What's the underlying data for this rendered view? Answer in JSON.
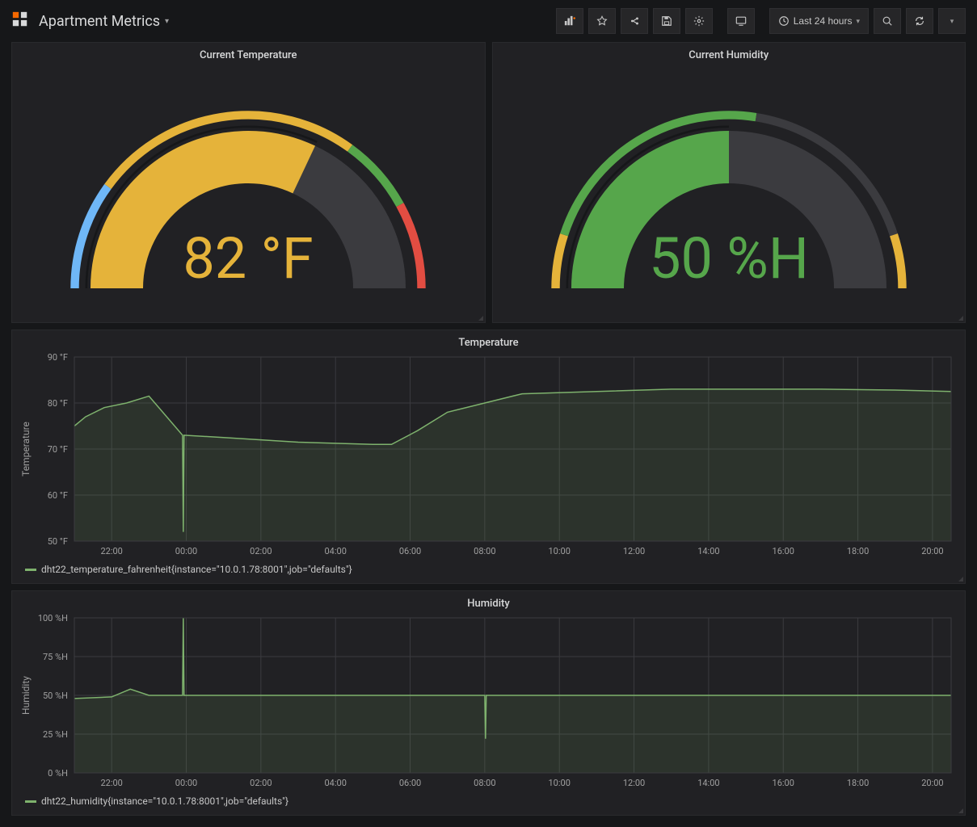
{
  "header": {
    "title": "Apartment Metrics",
    "time_range_label": "Last 24 hours"
  },
  "gauges": {
    "temperature_title": "Current Temperature",
    "temperature_value": "82 °F",
    "humidity_title": "Current Humidity",
    "humidity_value": "50 %H"
  },
  "temp_chart": {
    "title": "Temperature",
    "ylabel": "Temperature",
    "legend": "dht22_temperature_fahrenheit{instance=\"10.0.1.78:8001\",job=\"defaults\"}"
  },
  "hum_chart": {
    "title": "Humidity",
    "ylabel": "Humidity",
    "legend": "dht22_humidity{instance=\"10.0.1.78:8001\",job=\"defaults\"}"
  },
  "chart_data": [
    {
      "type": "gauge",
      "title": "Current Temperature",
      "value": 82,
      "unit": "°F",
      "min": 50,
      "max": 100,
      "thresholds": [
        {
          "from": 50,
          "to": 60,
          "color": "#6fb7f7"
        },
        {
          "from": 60,
          "to": 85,
          "color": "#e5b33a"
        },
        {
          "from": 85,
          "to": 92,
          "color": "#56a64b"
        },
        {
          "from": 92,
          "to": 100,
          "color": "#e24d42"
        }
      ]
    },
    {
      "type": "gauge",
      "title": "Current Humidity",
      "value": 50,
      "unit": "%H",
      "min": 0,
      "max": 100,
      "thresholds": [
        {
          "from": 0,
          "to": 10,
          "color": "#e5b33a"
        },
        {
          "from": 10,
          "to": 55,
          "color": "#56a64b"
        },
        {
          "from": 55,
          "to": 90,
          "color": "#3b3b3f"
        },
        {
          "from": 90,
          "to": 100,
          "color": "#e5b33a"
        }
      ]
    },
    {
      "type": "area",
      "title": "Temperature",
      "ylabel": "Temperature",
      "yunit": "°F",
      "ylim": [
        50,
        90
      ],
      "yticks": [
        50,
        60,
        70,
        80,
        90
      ],
      "x_labels": [
        "22:00",
        "00:00",
        "02:00",
        "04:00",
        "06:00",
        "08:00",
        "10:00",
        "12:00",
        "14:00",
        "16:00",
        "18:00",
        "20:00"
      ],
      "series": [
        {
          "name": "dht22_temperature_fahrenheit{instance=\"10.0.1.78:8001\",job=\"defaults\"}",
          "color": "#7eb26d",
          "x": [
            0,
            0.3,
            0.8,
            1.4,
            2,
            2.9,
            2.92,
            2.94,
            4,
            6,
            8,
            8.5,
            9.2,
            10,
            12,
            14,
            16,
            18,
            20,
            22,
            23.5
          ],
          "y": [
            75,
            77,
            79,
            80,
            81.5,
            73,
            52,
            73,
            72.5,
            71.5,
            71,
            71,
            74,
            78,
            82,
            82.5,
            83,
            83,
            83,
            82.8,
            82.5
          ]
        }
      ]
    },
    {
      "type": "area",
      "title": "Humidity",
      "ylabel": "Humidity",
      "yunit": "%H",
      "ylim": [
        0,
        100
      ],
      "yticks": [
        0,
        25,
        50,
        75,
        100
      ],
      "x_labels": [
        "22:00",
        "00:00",
        "02:00",
        "04:00",
        "06:00",
        "08:00",
        "10:00",
        "12:00",
        "14:00",
        "16:00",
        "18:00",
        "20:00"
      ],
      "series": [
        {
          "name": "dht22_humidity{instance=\"10.0.1.78:8001\",job=\"defaults\"}",
          "color": "#7eb26d",
          "x": [
            0,
            1,
            1.5,
            2,
            2.9,
            2.92,
            2.94,
            4,
            6,
            8,
            10,
            11.0,
            11.02,
            11.04,
            12,
            14,
            16,
            18,
            20,
            22,
            23.5
          ],
          "y": [
            48,
            49,
            54,
            50,
            50,
            100,
            50,
            50,
            50,
            50,
            50,
            50,
            22,
            50,
            50,
            50,
            50,
            50,
            50,
            50,
            50
          ]
        }
      ]
    }
  ]
}
